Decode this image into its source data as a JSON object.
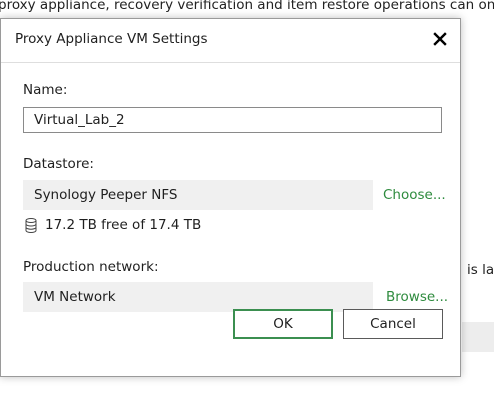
{
  "background": {
    "top_text": "proxy appliance, recovery verification and item restore operations can only",
    "side_text": "is lab"
  },
  "dialog": {
    "title": "Proxy Appliance VM Settings",
    "close_icon": "close-icon",
    "name_label": "Name:",
    "name_value": "Virtual_Lab_2",
    "datastore_label": "Datastore:",
    "datastore_value": "Synology Peeper NFS",
    "choose_link": "Choose...",
    "datastore_icon": "database-icon",
    "free_space": "17.2 TB free of 17.4 TB",
    "network_label": "Production network:",
    "network_value": "VM Network",
    "browse_link": "Browse...",
    "ok_label": "OK",
    "cancel_label": "Cancel"
  },
  "colors": {
    "link": "#2e8b3e",
    "ok_border": "#3b8f50",
    "readonly_field": "#f0f0f0"
  }
}
